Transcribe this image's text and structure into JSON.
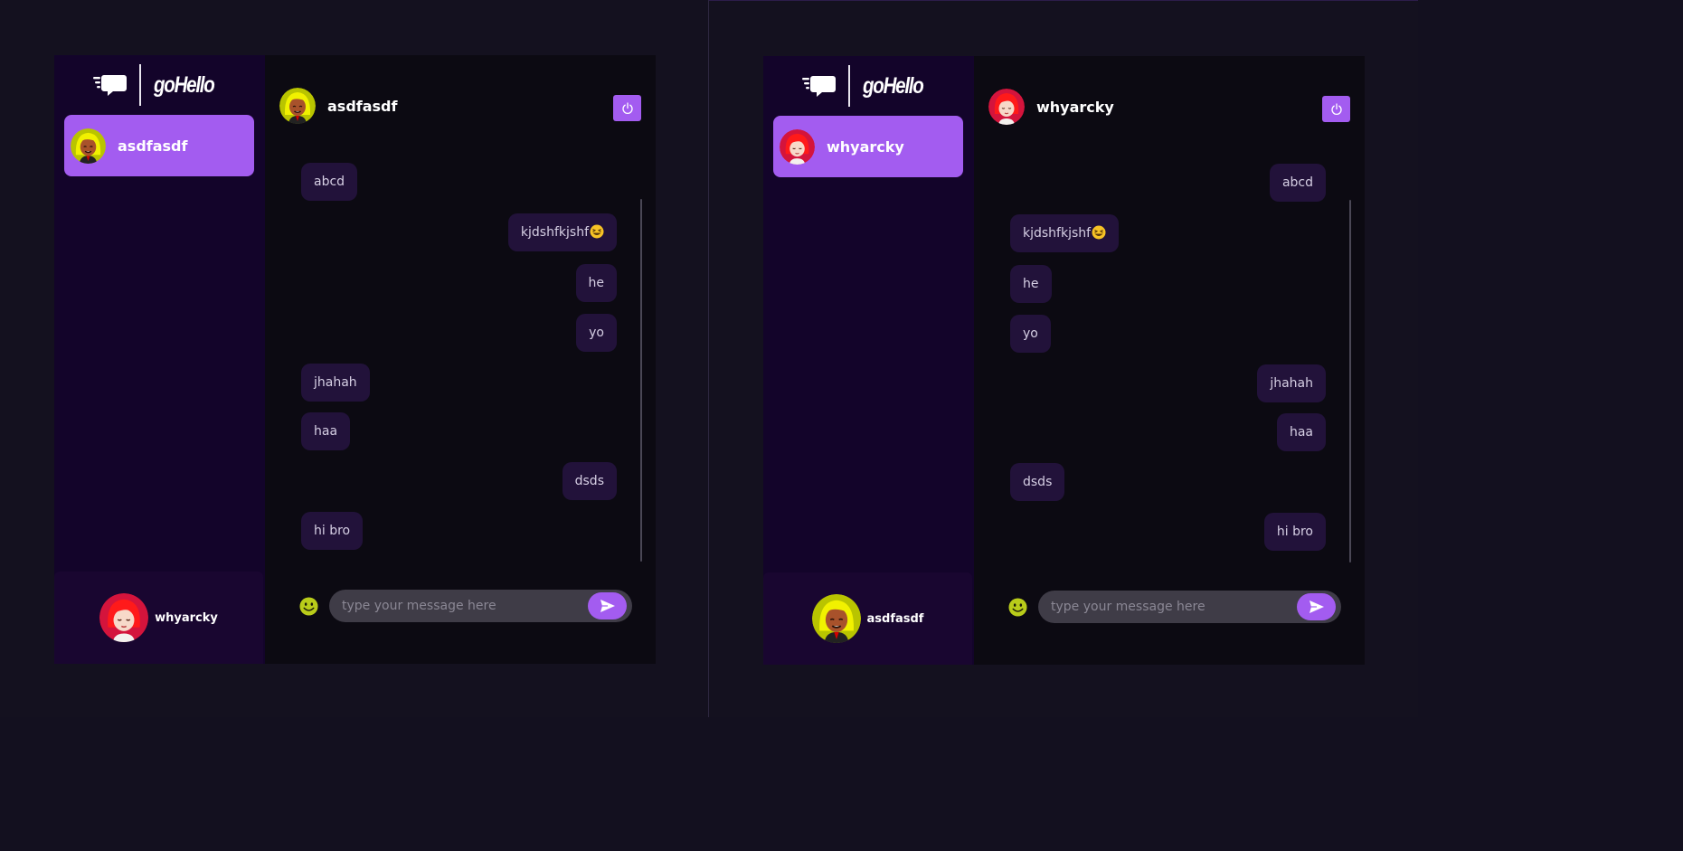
{
  "brand": {
    "wordmark": "goHello"
  },
  "colors": {
    "accent": "#a35cf0",
    "sidebar": "#13042a",
    "bubble": "#22123a",
    "background": "#13101f"
  },
  "icons": {
    "logo": "chat-bubble-icon",
    "power": "power-icon",
    "emoji": "smiley-icon",
    "send": "send-icon"
  },
  "left": {
    "contact": {
      "name": "asdfasdf"
    },
    "header": {
      "name": "asdfasdf"
    },
    "profile": {
      "name": "whyarcky"
    },
    "composer": {
      "placeholder": "type your message here"
    },
    "messages": [
      {
        "text": "abcd",
        "dir": "in"
      },
      {
        "text": "kjdshfkjshf",
        "emoji": "grinning-squinting-face",
        "dir": "out"
      },
      {
        "text": "he",
        "dir": "out"
      },
      {
        "text": "yo",
        "dir": "out"
      },
      {
        "text": "jhahah",
        "dir": "in"
      },
      {
        "text": "haa",
        "dir": "in"
      },
      {
        "text": "dsds",
        "dir": "out"
      },
      {
        "text": "hi bro",
        "dir": "in"
      }
    ]
  },
  "right": {
    "contact": {
      "name": "whyarcky"
    },
    "header": {
      "name": "whyarcky"
    },
    "profile": {
      "name": "asdfasdf"
    },
    "composer": {
      "placeholder": "type your message here"
    },
    "messages": [
      {
        "text": "abcd",
        "dir": "out"
      },
      {
        "text": "kjdshfkjshf",
        "emoji": "grinning-squinting-face",
        "dir": "in"
      },
      {
        "text": "he",
        "dir": "in"
      },
      {
        "text": "yo",
        "dir": "in"
      },
      {
        "text": "jhahah",
        "dir": "out"
      },
      {
        "text": "haa",
        "dir": "out"
      },
      {
        "text": "dsds",
        "dir": "in"
      },
      {
        "text": "hi bro",
        "dir": "out"
      }
    ]
  }
}
